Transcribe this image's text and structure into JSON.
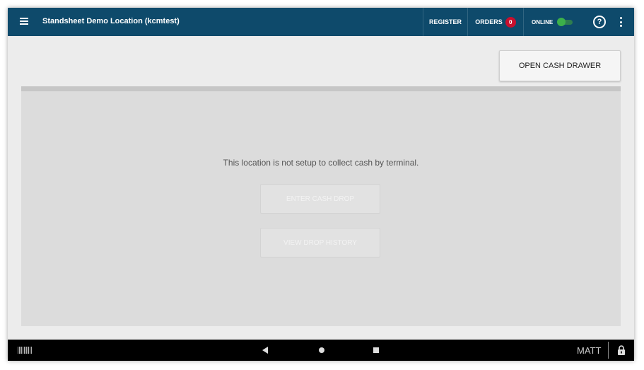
{
  "topbar": {
    "title": "Standsheet Demo Location (kcmtest)",
    "register_label": "REGISTER",
    "orders_label": "ORDERS",
    "orders_count": "0",
    "online_label": "ONLINE",
    "help_glyph": "?"
  },
  "actions": {
    "open_cash_drawer": "OPEN CASH DRAWER"
  },
  "main": {
    "message": "This location is not setup to collect cash by terminal.",
    "enter_cash_drop": "ENTER CASH DROP",
    "view_drop_history": "VIEW DROP HISTORY"
  },
  "navbar": {
    "user": "MATT"
  },
  "colors": {
    "topbar_bg": "#0e4a6b",
    "badge": "#c8102e",
    "online_toggle": "#3cb04a"
  },
  "icons": [
    "menu-icon",
    "toggle-switch",
    "help-icon",
    "more-vert-icon",
    "barcode-icon",
    "back-icon",
    "home-icon",
    "recents-icon",
    "lock-icon"
  ]
}
